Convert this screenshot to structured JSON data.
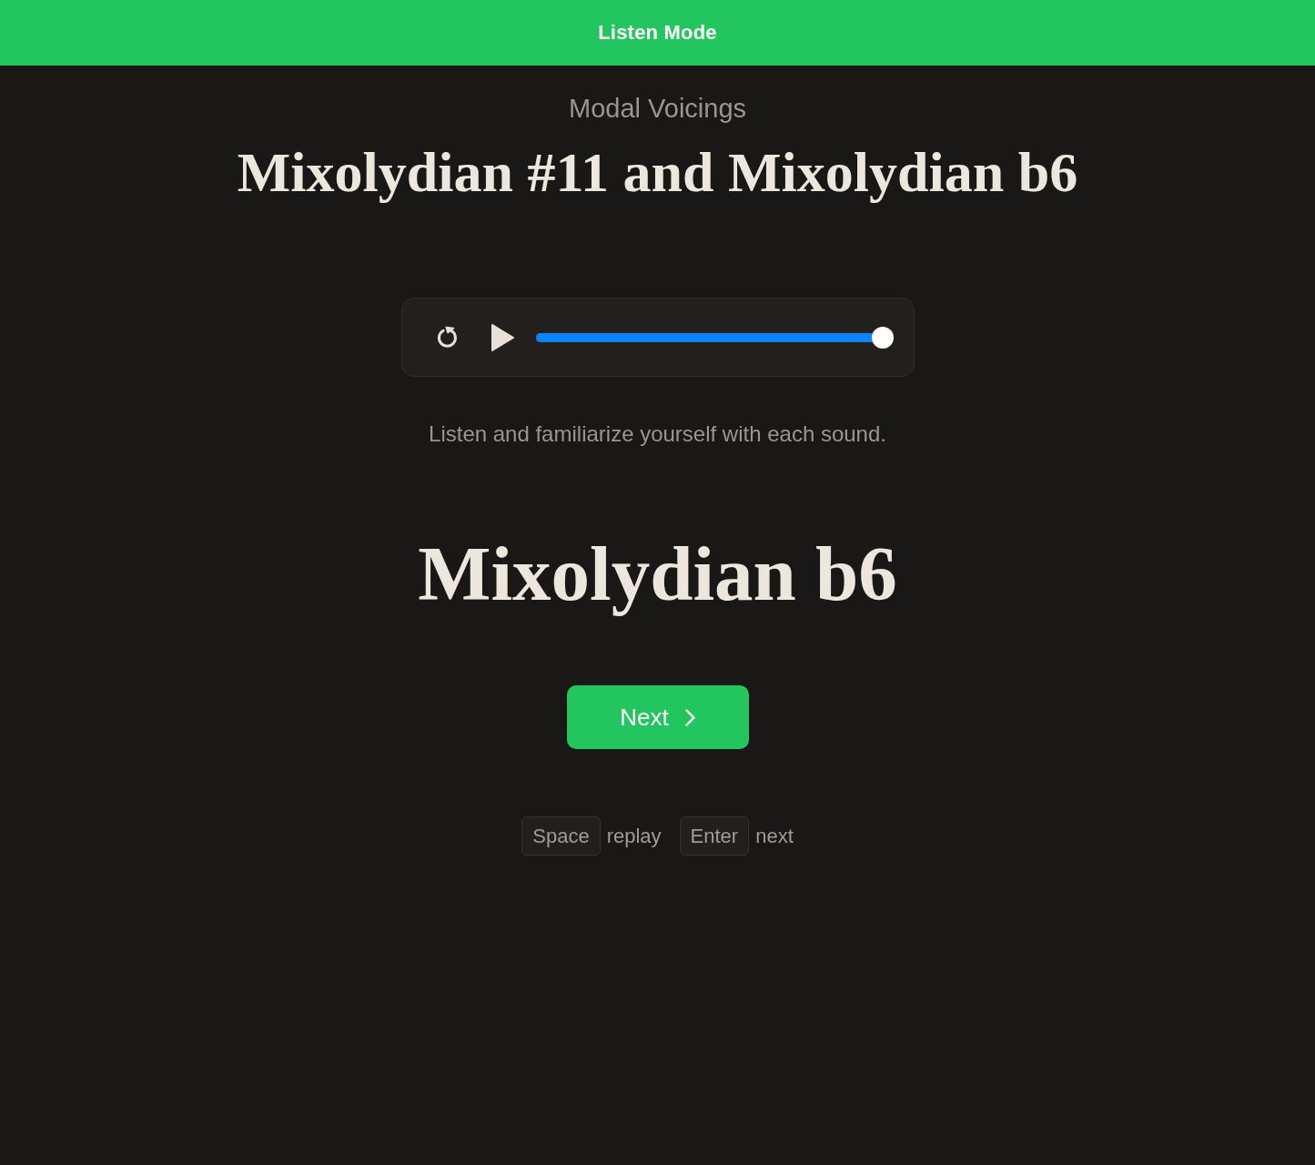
{
  "header": {
    "title": "Listen Mode"
  },
  "lesson": {
    "category": "Modal Voicings",
    "title": "Mixolydian #11 and Mixolydian b6"
  },
  "player": {
    "playing": false,
    "level": 1.0
  },
  "instruction": "Listen and familiarize yourself with each sound.",
  "answer": "Mixolydian b6",
  "next_button": {
    "label": "Next"
  },
  "shortcuts": [
    {
      "key": "Space",
      "action": "replay"
    },
    {
      "key": "Enter",
      "action": "next"
    }
  ]
}
